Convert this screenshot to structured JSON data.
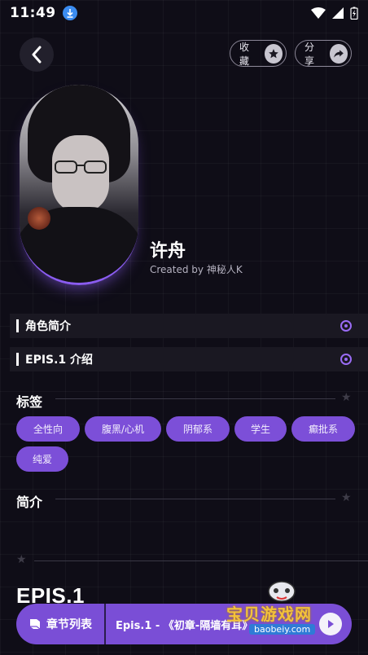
{
  "status_bar": {
    "time": "11:49"
  },
  "header": {
    "collect_label": "收藏",
    "share_label": "分享"
  },
  "character": {
    "name": "许舟",
    "created_by": "Created by 神秘人K"
  },
  "sections": [
    {
      "label": "角色简介"
    },
    {
      "label": "EPIS.1 介绍"
    }
  ],
  "tags_block": {
    "title": "标签",
    "tags": [
      "全性向",
      "腹黑/心机",
      "阴郁系",
      "学生",
      "癫批系",
      "纯爱"
    ]
  },
  "intro_block": {
    "title": "简介"
  },
  "episode": {
    "title": "EPIS.1"
  },
  "bottom_bar": {
    "chapters_label": "章节列表",
    "continue_text": "Epis.1 - 《初章-隔墙有耳》"
  },
  "watermark": {
    "text": "宝贝游戏网",
    "url": "baobeiy.com"
  },
  "colors": {
    "accent": "#7a4ed6",
    "background": "#0f0d17",
    "dot": "#9a6cf5"
  }
}
